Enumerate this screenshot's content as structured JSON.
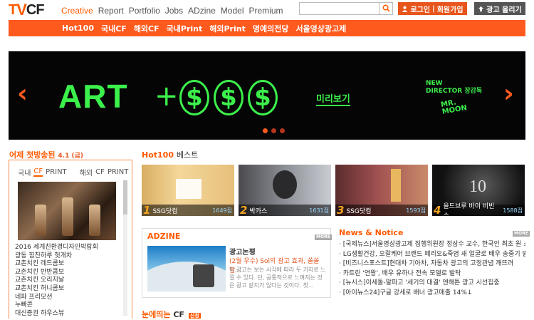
{
  "logo": {
    "part1": "T",
    "part2": "V",
    "part3": "CF"
  },
  "topnav": [
    "Creative",
    "Report",
    "Portfolio",
    "Jobs",
    "ADzine",
    "Model",
    "Premium"
  ],
  "search": {
    "placeholder": "",
    "icon": "search-icon"
  },
  "login_button": "로그인",
  "join_button": "회원가입",
  "upload_button": "광고 올리기",
  "subnav": [
    "Hot100",
    "국내CF",
    "해외CF",
    "국내Print",
    "해외Print",
    "명예의전당",
    "서울영상광고제"
  ],
  "banner": {
    "headline": "ART",
    "plus": "+",
    "coin_symbol": "$",
    "more_label": "미리보기",
    "director_line1": "NEW",
    "director_line2": "DIRECTOR 장감독",
    "mr_moon_line1": "MR.",
    "mr_moon_line2": "MOON"
  },
  "yesterday": {
    "title": "어제 첫방송된",
    "date": "4.1 (금)",
    "tabs_domestic_label": "국내",
    "tabs_overseas_label": "해외",
    "tab_cf": "CF",
    "tab_print": "PRINT",
    "list": [
      "2016 세계친환경디자인박람회",
      "광동 힘찬하루 헛개차",
      "교촌치킨 레드콤보",
      "교촌치킨 반반콤보",
      "교촌치킨 오리지날",
      "교촌치킨 허니콤보",
      "네파 프리모션",
      "누빠콘",
      "대신증권 하우스뷰"
    ]
  },
  "hot100": {
    "title": "Hot100",
    "title_suffix": "베스트",
    "cards": [
      {
        "rank": "1",
        "title": "SSG닷컴",
        "count": "1649점"
      },
      {
        "rank": "2",
        "title": "박카스",
        "count": "1631점"
      },
      {
        "rank": "3",
        "title": "SSG닷컴",
        "count": "1593점"
      },
      {
        "rank": "4",
        "title": "올드브루 바이 비빈스...",
        "count": "1588점"
      }
    ]
  },
  "adzine": {
    "title": "ADZINE",
    "more": "MORE",
    "article_title": "광고논평",
    "article_sub": "(2월 우수) Sol의 광고 효과, 쏠쏠할...",
    "article_desc": "이 광고는 보는 시각에 따라 두 가지로 느낄 수 있다. 단, 공통적으로 느껴지는 것은 광고 같지가 않다는 것이다. 첫..."
  },
  "news": {
    "title": "News & Notice",
    "more": "MORE",
    "items": [
      "· [국제뉴스]서울영상광고제 집행위원장 정상수 교수, 한국인 최초 원 쇼 ...",
      "· LG생활건강, 오랄케어 브랜드 페리오&죽염 새 얼굴로 배우 송중기 발탁",
      "· [비즈니스포스트]현대차 기아차, 자동차 광고의 고정관념 깨뜨려",
      "· 카트린 '연왕', 배우 유하나 전속 모델로 발탁",
      "· [뉴시스]이세돌-알파고 '세기의 대결' 앤해튼 광고 시선집중",
      "· [아이뉴스24]구글 강세로 배너 광고매출 14%↓"
    ]
  },
  "bottom": {
    "title": "눈에띄는",
    "title_cf": "CF",
    "badge": "신청"
  }
}
